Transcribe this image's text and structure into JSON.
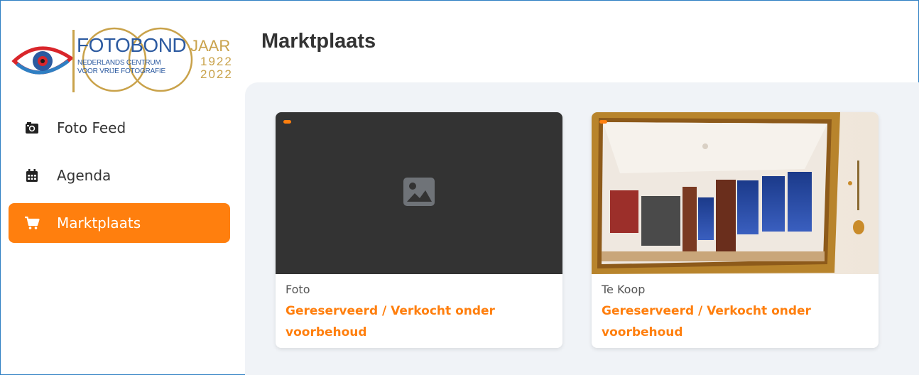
{
  "logo": {
    "title": "FOTOBOND",
    "jaar": "JAAR",
    "subtitle_line1": "NEDERLANDS CENTRUM",
    "subtitle_line2": "VOOR VRIJE FOTOGRAFIE",
    "year_start": "1922",
    "year_end": "2022",
    "brand_blue": "#2c5aa0",
    "brand_gold": "#c9a24a"
  },
  "sidebar": {
    "items": [
      {
        "label": "Foto Feed",
        "icon": "camera-icon",
        "active": false
      },
      {
        "label": "Agenda",
        "icon": "calendar-icon",
        "active": false
      },
      {
        "label": "Marktplaats",
        "icon": "cart-icon",
        "active": true
      }
    ]
  },
  "main": {
    "title": "Marktplaats",
    "cards": [
      {
        "category": "Foto",
        "status": "Gereserveerd / Verkocht onder voorbehoud",
        "image": "image-placeholder-icon"
      },
      {
        "category": "Te Koop",
        "status": "Gereserveerd / Verkocht onder voorbehoud",
        "image": "mirror-photo"
      }
    ]
  },
  "colors": {
    "accent": "#ff7f0e",
    "content_bg": "#f0f3f7",
    "placeholder_bg": "#333333"
  }
}
